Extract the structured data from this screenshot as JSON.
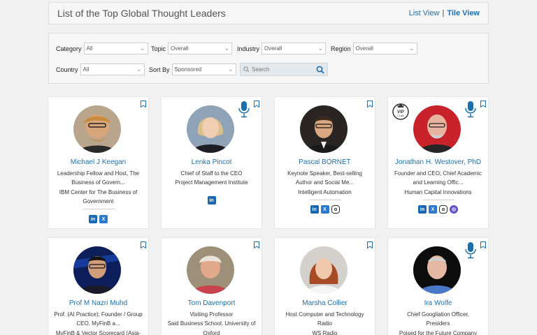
{
  "header": {
    "title": "List of the Top Global Thought Leaders",
    "list_view": "List View",
    "tile_view": "Tile View"
  },
  "filters": {
    "category": {
      "label": "Category",
      "value": "All"
    },
    "topic": {
      "label": "Topic",
      "value": "Overall"
    },
    "industry": {
      "label": "Industry",
      "value": "Overall"
    },
    "region": {
      "label": "Region",
      "value": "Overall"
    },
    "country": {
      "label": "Country",
      "value": "All"
    },
    "sort_by": {
      "label": "Sort By",
      "value": "Sponsored"
    },
    "search_placeholder": "Search"
  },
  "cards": [
    {
      "name": "Michael J Keegan",
      "lines": [
        "Leadership Fellow and Host, The",
        "Business of Govern...",
        "IBM Center for The Business of",
        "Government"
      ]
    },
    {
      "name": "Lenka Pincot",
      "lines": [
        "Chief of Staff to the CEO",
        "Project Management Institute"
      ]
    },
    {
      "name": "Pascal BORNET",
      "lines": [
        "Keynote Speaker, Best-selling",
        "Author and Social Me...",
        "Intelligent Automation"
      ]
    },
    {
      "name": "Jonathan H. Westover, PhD",
      "lines": [
        "Founder and CEO; Chief Academic",
        "and Learning Offic...",
        "Human Capital Innovations"
      ],
      "badge": "VIP CLUB"
    },
    {
      "name": "Prof M Nazri Muhd",
      "lines": [
        "Prof. (AI Practice); Founder / Group",
        "CEO, MyFinB a...",
        "MyFinB & Vector Scorecard (Asia-"
      ]
    },
    {
      "name": "Tom Davenport",
      "lines": [
        "Visiting Professor",
        "Said Business School, University of",
        "Oxford"
      ]
    },
    {
      "name": "Marsha Collier",
      "lines": [
        "Host Computer and Technology",
        "Radio",
        "WS Radio"
      ]
    },
    {
      "name": "Ira Wolfe",
      "lines": [
        "Chief Googliation Officer,",
        "Presiders",
        "Poised for the Future Company"
      ]
    }
  ],
  "colors": {
    "link": "#1b6fae",
    "linkedin": "#1a68b3",
    "twitter": "#2b7ad0"
  }
}
